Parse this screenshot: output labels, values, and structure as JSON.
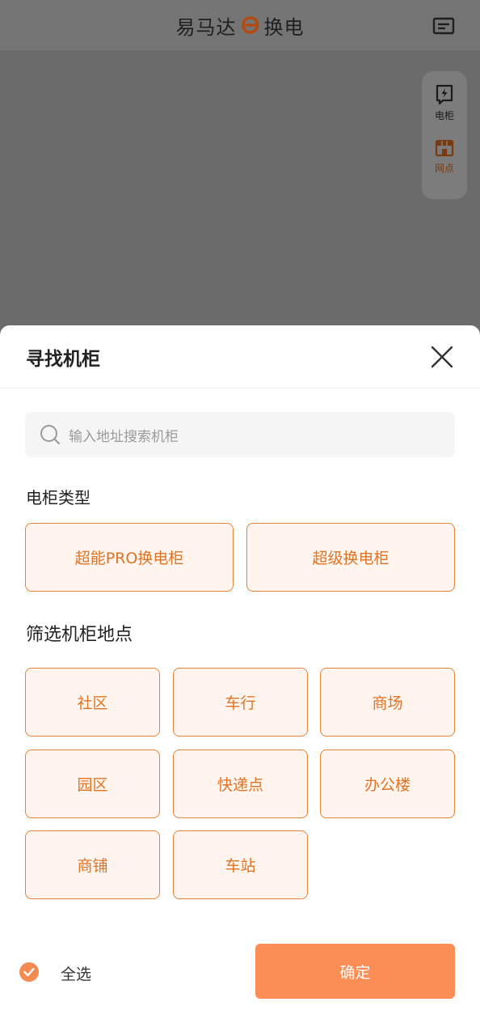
{
  "header": {
    "brand_prefix": "易马达",
    "brand_suffix": "换电"
  },
  "side_panel": {
    "items": [
      {
        "label": "电柜",
        "icon": "cabinet-bolt-icon"
      },
      {
        "label": "网点",
        "icon": "store-icon"
      }
    ]
  },
  "sheet": {
    "title": "寻找机柜",
    "search": {
      "placeholder": "输入地址搜索机柜"
    },
    "cabinet_type": {
      "title": "电柜类型",
      "options": [
        "超能PRO换电柜",
        "超级换电柜"
      ]
    },
    "location_filter": {
      "title": "筛选机柜地点",
      "options": [
        "社区",
        "车行",
        "商场",
        "园区",
        "快递点",
        "办公楼",
        "商铺",
        "车站"
      ]
    },
    "footer": {
      "select_all_label": "全选",
      "select_all_checked": true,
      "confirm_label": "确定"
    }
  },
  "colors": {
    "accent": "#e07426",
    "accent_border": "#e8833a",
    "option_bg": "#fff5ee",
    "confirm_bg": "#fb8d57",
    "overlay": "#6b6b6b"
  }
}
